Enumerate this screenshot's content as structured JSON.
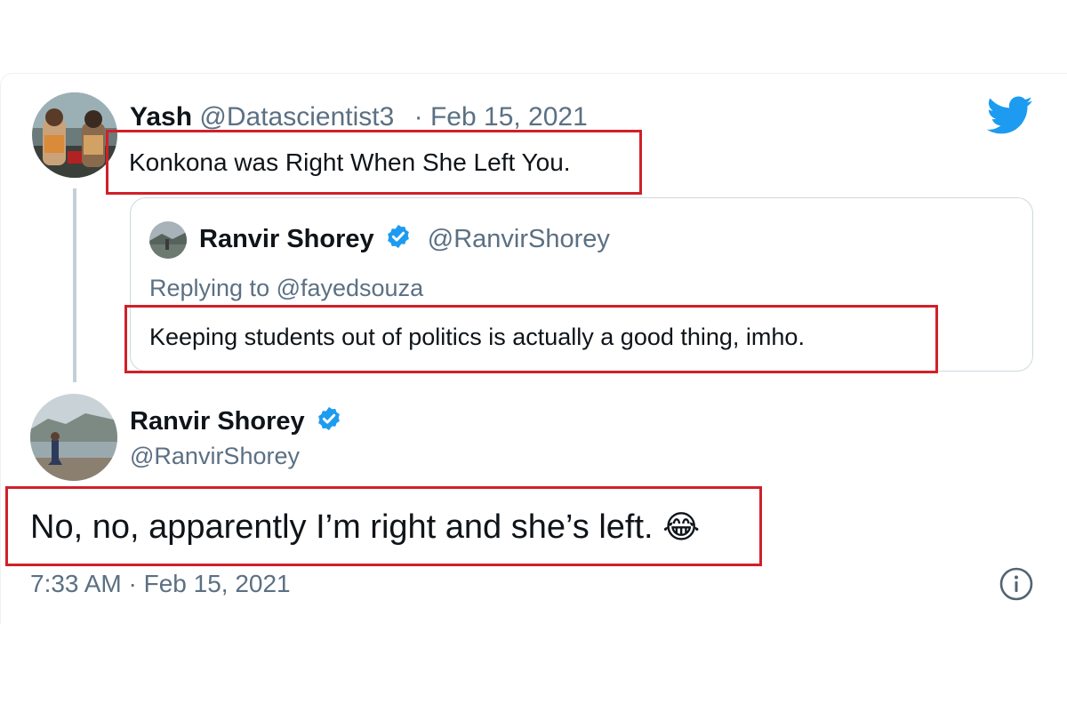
{
  "reply": {
    "name": "Yash",
    "handle": "@Datascientist3",
    "separator": "·",
    "date": "Feb 15, 2021",
    "text": "Konkona was Right When She Left You."
  },
  "quoted": {
    "name": "Ranvir Shorey",
    "handle": "@RanvirShorey",
    "replying_to": "Replying to @fayedsouza",
    "text": "Keeping students out of politics is actually a good thing, imho."
  },
  "main": {
    "name": "Ranvir Shorey",
    "handle": "@RanvirShorey",
    "text": "No, no, apparently I’m right and she’s left.",
    "emoji": "😂",
    "timestamp": "7:33 AM · Feb 15, 2021"
  },
  "colors": {
    "highlight_box": "#d0202a",
    "twitter_blue": "#1d9bf0",
    "muted_text": "#5b7083"
  },
  "icons": {
    "brand": "twitter-bird-icon",
    "verified": "verified-badge-icon",
    "info": "info-icon"
  }
}
